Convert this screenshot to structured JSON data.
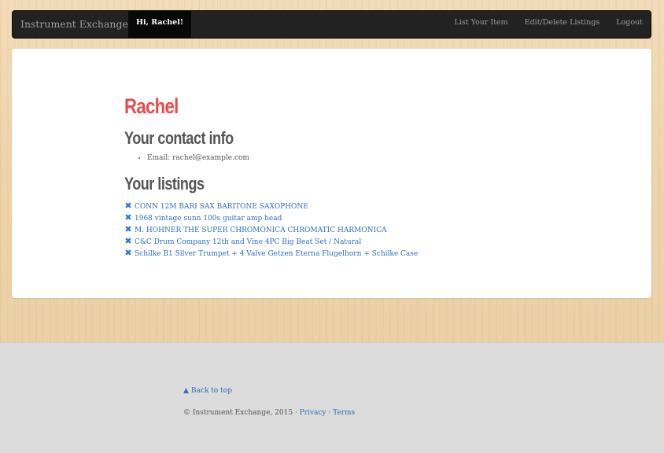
{
  "navbar": {
    "brand": "Instrument Exchange",
    "greeting": "Hi, Rachel!",
    "links": [
      "List Your Item",
      "Edit/Delete Listings",
      "Logout"
    ]
  },
  "profile": {
    "name": "Rachel",
    "contact_heading": "Your contact info",
    "email": "Email: rachel@example.com",
    "listings_heading": "Your listings",
    "listings": [
      "CONN 12M BARI SAX BARITONE SAXOPHONE",
      "1968 vintage sunn 100s guitar amp head",
      "M. HOHNER THE SUPER CHROMONICA CHROMATIC HARMONICA",
      "C&C Drum Company 12th and Vine 4PC Big Beat Set / Natural",
      "Schilke B1 Silver Trumpet + 4 Valve Getzen Eterna Flugelhorn + Schilke Case"
    ]
  },
  "footer": {
    "back_to_top": "Back to top",
    "copyright": "© Instrument Exchange, 2015 ·",
    "privacy": "Privacy",
    "separator": "·",
    "terms": "Terms"
  },
  "colors": {
    "accent_name": "#e64b4b",
    "link": "#2b6fbf",
    "navbar_bg": "#222222"
  },
  "icons": {
    "remove": "remove-x-icon",
    "back_to_top": "chevron-up-icon"
  }
}
